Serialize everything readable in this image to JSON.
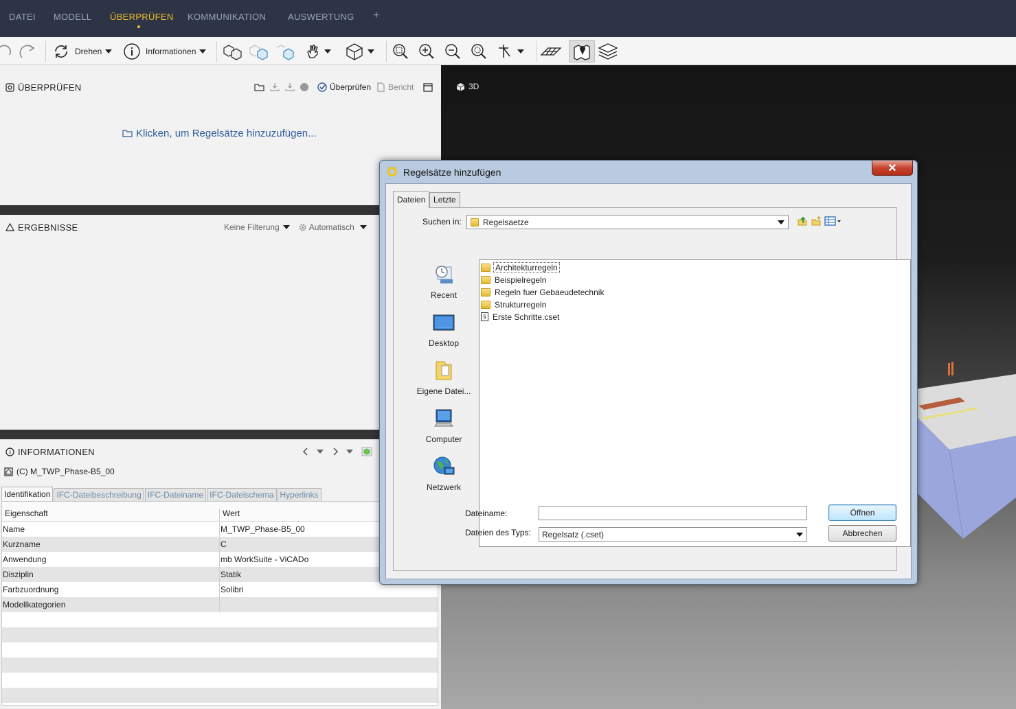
{
  "menu": {
    "items": [
      "DATEI",
      "MODELL",
      "ÜBERPRÜFEN",
      "KOMMUNIKATION",
      "AUSWERTUNG"
    ],
    "active": "ÜBERPRÜFEN",
    "add": "+"
  },
  "toolbar": {
    "rotate_label": "Drehen",
    "info_label": "Informationen"
  },
  "check_panel": {
    "title": "ÜBERPRÜFEN",
    "check_label": "Überprüfen",
    "report_label": "Bericht",
    "hint": "Klicken, um Regelsätze hinzuzufügen..."
  },
  "results_panel": {
    "title": "ERGEBNISSE",
    "filter_label": "Keine Filterung",
    "auto_label": "Automatisch"
  },
  "info_panel": {
    "title": "INFORMATIONEN",
    "model_path": "(C) M_TWP_Phase-B5_00",
    "tabs": [
      "Identifikation",
      "IFC-Dateibeschreibung",
      "IFC-Dateiname",
      "IFC-Dateischema",
      "Hyperlinks"
    ],
    "active_tab": "Identifikation",
    "columns": [
      "Eigenschaft",
      "Wert"
    ],
    "rows": [
      {
        "key": "Name",
        "value": "M_TWP_Phase-B5_00"
      },
      {
        "key": "Kurzname",
        "value": "C"
      },
      {
        "key": "Anwendung",
        "value": "mb WorkSuite - ViCADo"
      },
      {
        "key": "Disziplin",
        "value": "Statik"
      },
      {
        "key": "Farbzuordnung",
        "value": "Solibri"
      },
      {
        "key": "Modellkategorien",
        "value": ""
      }
    ]
  },
  "viewport": {
    "label": "3D"
  },
  "dialog": {
    "title": "Regelsätze hinzufügen",
    "close": "✕",
    "tabs": [
      "Dateien",
      "Letzte"
    ],
    "look_in_label": "Suchen in:",
    "look_in_value": "Regelsaetze",
    "places": [
      "Recent",
      "Desktop",
      "Eigene Datei...",
      "Computer",
      "Netzwerk"
    ],
    "files": [
      {
        "name": "Architekturregeln",
        "type": "folder"
      },
      {
        "name": "Beispielregeln",
        "type": "folder"
      },
      {
        "name": "Regeln fuer Gebaeudetechnik",
        "type": "folder"
      },
      {
        "name": "Strukturregeln",
        "type": "folder"
      },
      {
        "name": "Erste Schritte.cset",
        "type": "file"
      }
    ],
    "filename_label": "Dateiname:",
    "filename_value": "",
    "filetype_label": "Dateien des Typs:",
    "filetype_value": "Regelsatz (.cset)",
    "open_button": "Öffnen",
    "cancel_button": "Abbrechen"
  },
  "colors": {
    "menubar_bg": "#2d3446",
    "menu_active": "#f4c024",
    "link_blue": "#2f5e9e"
  }
}
